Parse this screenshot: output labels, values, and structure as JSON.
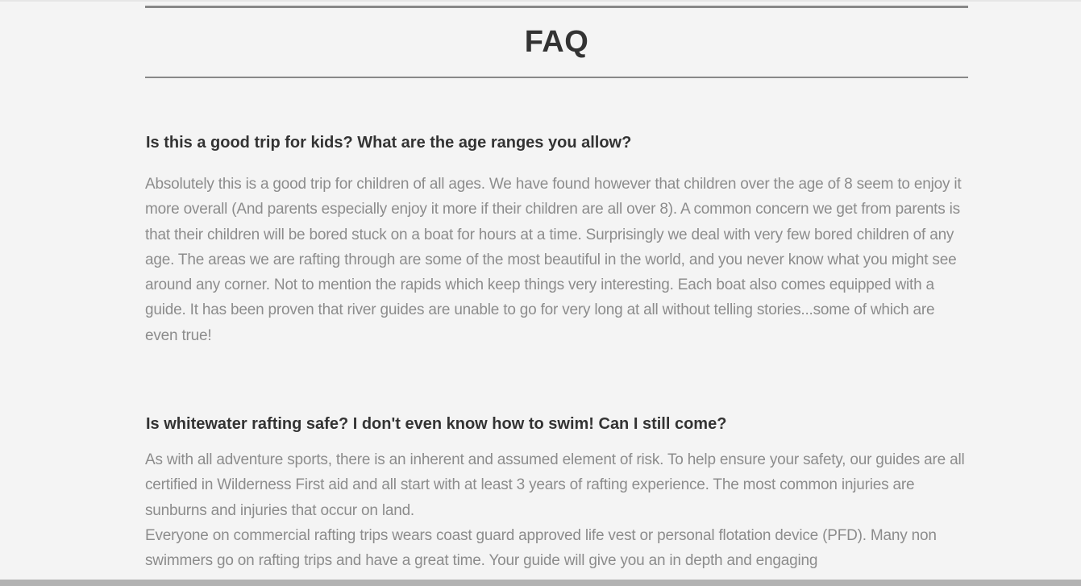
{
  "faq": {
    "title": "FAQ",
    "items": [
      {
        "question": "Is this a good trip for kids? What are the age ranges you allow?",
        "answer": [
          "Absolutely this is a good trip for children of all ages. We have found however that children over the age of 8 seem to enjoy it more overall (And parents especially enjoy it more if their children are all over 8). A common concern we get from parents is that their children will be bored stuck on a boat for hours at a time. Surprisingly we deal with very few bored children of any age. The areas we are rafting through are some of the most beautiful in the world, and you never know what you might see around any corner. Not to mention the rapids which keep things very interesting. Each boat also comes equipped with a guide. It has been proven that river guides are unable to go for very long at all without telling stories...some of which are even true!"
        ]
      },
      {
        "question": "Is whitewater rafting safe? I don't even know how to swim! Can I still come?",
        "answer": [
          "As with all adventure sports, there is an inherent and assumed element of risk. To help ensure your safety, our guides are all certified in Wilderness First aid and all start with at least 3 years of rafting experience. The most common injuries are sunburns and injuries that occur on land.",
          "Everyone on commercial rafting trips wears coast guard approved life vest or personal flotation device (PFD). Many non swimmers go on rafting trips and have a great time. Your guide will give you an in depth and engaging"
        ]
      }
    ]
  }
}
